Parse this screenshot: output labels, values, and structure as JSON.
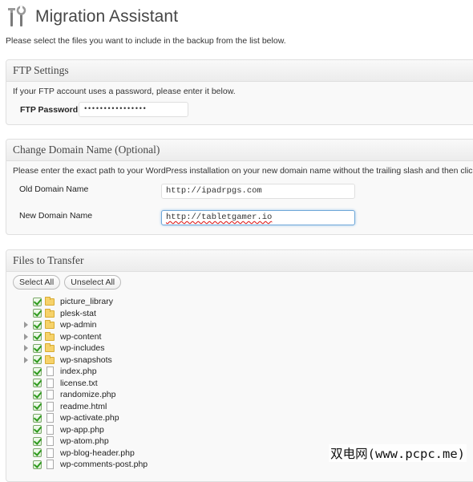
{
  "page": {
    "title": "Migration Assistant",
    "intro": "Please select the files you want to include in the backup from the list below."
  },
  "ftp": {
    "heading": "FTP Settings",
    "description": "If your FTP account uses a password, please enter it below.",
    "password_label": "FTP Password:",
    "password_value": "••••••••••••••••"
  },
  "domain": {
    "heading": "Change Domain Name (Optional)",
    "description": "Please enter the exact path to your WordPress installation on your new domain name without the trailing slash and then click Start Mi",
    "old_label": "Old Domain Name",
    "old_value": "http://ipadrpgs.com",
    "new_label": "New Domain Name",
    "new_value": "http://tabletgamer.io"
  },
  "files": {
    "heading": "Files to Transfer",
    "select_all": "Select All",
    "unselect_all": "Unselect All",
    "items": [
      {
        "name": "picture_library",
        "type": "folder",
        "expandable": false,
        "checked": true
      },
      {
        "name": "plesk-stat",
        "type": "folder",
        "expandable": false,
        "checked": true
      },
      {
        "name": "wp-admin",
        "type": "folder",
        "expandable": true,
        "checked": true
      },
      {
        "name": "wp-content",
        "type": "folder",
        "expandable": true,
        "checked": true
      },
      {
        "name": "wp-includes",
        "type": "folder",
        "expandable": true,
        "checked": true
      },
      {
        "name": "wp-snapshots",
        "type": "folder",
        "expandable": true,
        "checked": true
      },
      {
        "name": "index.php",
        "type": "file",
        "expandable": false,
        "checked": true
      },
      {
        "name": "license.txt",
        "type": "file",
        "expandable": false,
        "checked": true
      },
      {
        "name": "randomize.php",
        "type": "file",
        "expandable": false,
        "checked": true
      },
      {
        "name": "readme.html",
        "type": "file",
        "expandable": false,
        "checked": true
      },
      {
        "name": "wp-activate.php",
        "type": "file",
        "expandable": false,
        "checked": true
      },
      {
        "name": "wp-app.php",
        "type": "file",
        "expandable": false,
        "checked": true
      },
      {
        "name": "wp-atom.php",
        "type": "file",
        "expandable": false,
        "checked": true
      },
      {
        "name": "wp-blog-header.php",
        "type": "file",
        "expandable": false,
        "checked": true
      },
      {
        "name": "wp-comments-post.php",
        "type": "file",
        "expandable": false,
        "checked": true
      }
    ]
  },
  "watermark": "双电网(www.pcpc.me)"
}
